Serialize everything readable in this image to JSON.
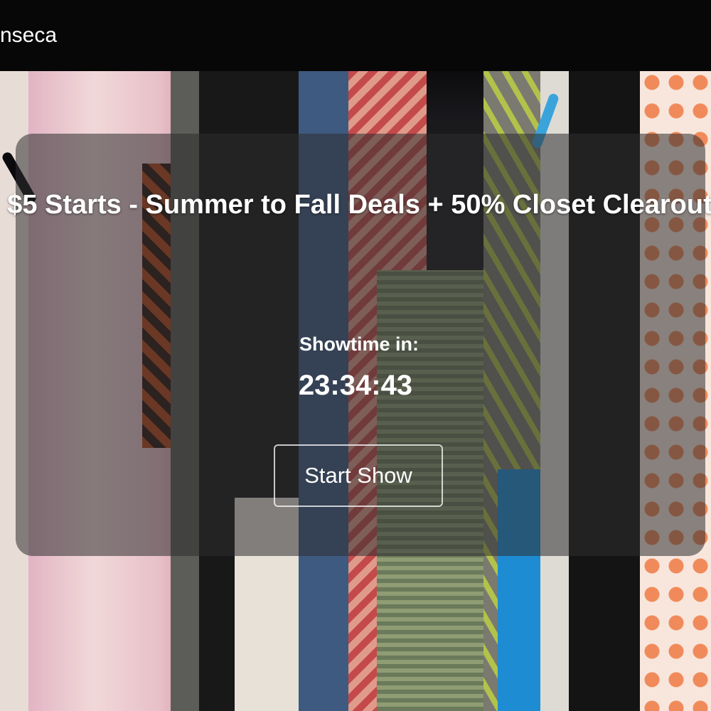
{
  "header": {
    "host_name": "nseca"
  },
  "show": {
    "title": "$5 Starts - Summer to Fall Deals + 50% Closet Clearout",
    "countdown_label": "Showtime in:",
    "countdown_value": "23:34:43",
    "start_button_label": "Start Show"
  },
  "colors": {
    "topbar": "#070708",
    "card_overlay": "rgba(45,45,48,0.55)",
    "text": "#ffffff"
  }
}
